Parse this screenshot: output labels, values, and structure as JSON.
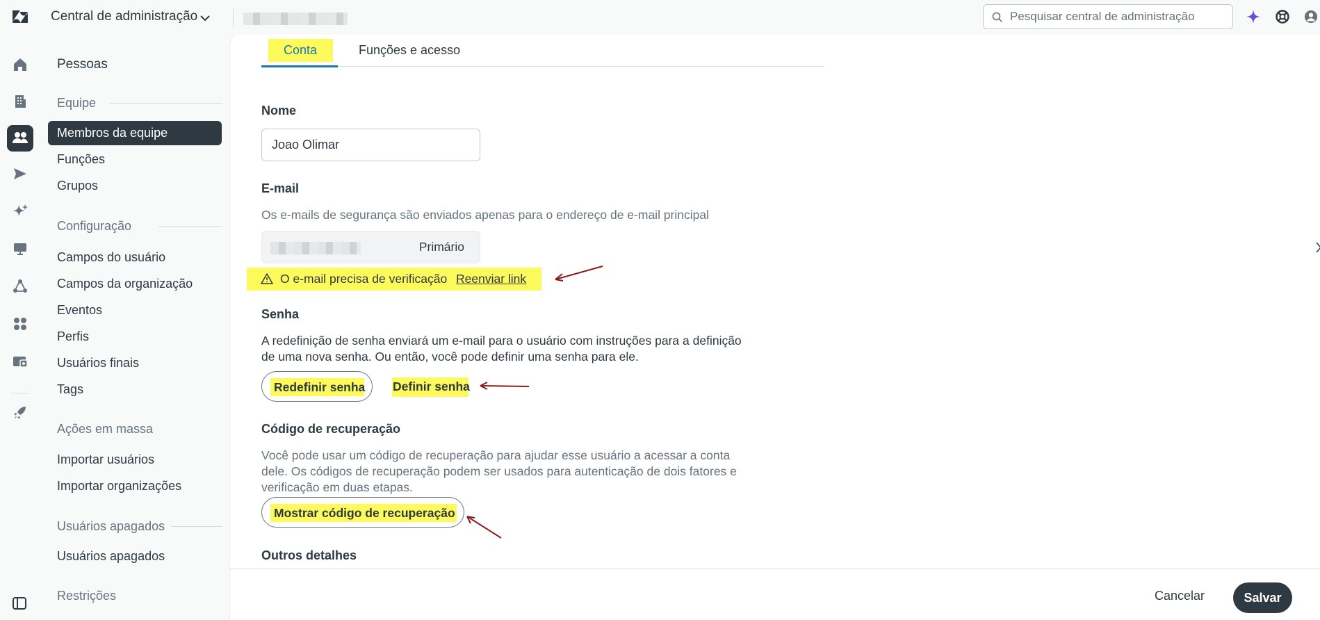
{
  "app": {
    "title": "Central de administração"
  },
  "search": {
    "placeholder": "Pesquisar central de administração"
  },
  "topbar_icons": [
    "ai-sparkle-icon",
    "help-lifebuoy-icon",
    "user-profile-icon"
  ],
  "rail": {
    "items": [
      {
        "name": "home-icon"
      },
      {
        "name": "building-icon"
      },
      {
        "name": "people-icon",
        "active": true
      },
      {
        "name": "send-channels-icon"
      },
      {
        "name": "ai-sparkle-icon"
      },
      {
        "name": "workspaces-monitor-icon"
      },
      {
        "name": "objects-rules-icon"
      },
      {
        "name": "apps-grid-icon"
      },
      {
        "name": "account-billing-icon"
      },
      {
        "name": "rocket-icon"
      }
    ]
  },
  "sidebar": {
    "title": "Pessoas",
    "sections": [
      {
        "label": "Equipe",
        "items": [
          "Membros da equipe",
          "Funções",
          "Grupos"
        ]
      },
      {
        "label": "Configuração",
        "items": [
          "Campos do usuário",
          "Campos da organização",
          "Eventos",
          "Perfis",
          "Usuários finais",
          "Tags"
        ]
      },
      {
        "label": "Ações em massa",
        "items": [
          "Importar usuários",
          "Importar organizações"
        ]
      },
      {
        "label": "Usuários apagados",
        "items": [
          "Usuários apagados"
        ]
      },
      {
        "label": "Restrições",
        "items": []
      }
    ],
    "active_item": "Membros da equipe"
  },
  "tabs": [
    {
      "label": "Conta",
      "active": true
    },
    {
      "label": "Funções e acesso",
      "active": false
    }
  ],
  "form": {
    "name": {
      "label": "Nome",
      "value": "Joao Olimar"
    },
    "email": {
      "label": "E-mail",
      "hint": "Os e-mails de segurança são enviados apenas para o endereço de e-mail principal",
      "badge": "Primário",
      "warning": "O e-mail precisa de verificação",
      "resend_link": "Reenviar link"
    },
    "password": {
      "label": "Senha",
      "description_line1": "A redefinição de senha enviará um e-mail para o usuário com instruções para a definição",
      "description_line2": "de uma nova senha. Ou então, você pode definir uma senha para ele.",
      "reset_button": "Redefinir senha",
      "set_button": "Definir senha"
    },
    "recovery": {
      "label": "Código de recuperação",
      "description_line1": "Você pode usar um código de recuperação para ajudar esse usuário a acessar a conta",
      "description_line2": "dele. Os códigos de recuperação podem ser usados para autenticação de dois fatores e",
      "description_line3": "verificação em duas etapas.",
      "show_button": "Mostrar código de recuperação"
    },
    "other_details": {
      "label": "Outros detalhes"
    }
  },
  "footer": {
    "cancel": "Cancelar",
    "save": "Salvar"
  },
  "colors": {
    "highlight": "#fdfa5b",
    "primary_dark": "#2f3941",
    "accent_blue": "#1f73b7",
    "annotation_arrow": "#8b1a1a"
  }
}
